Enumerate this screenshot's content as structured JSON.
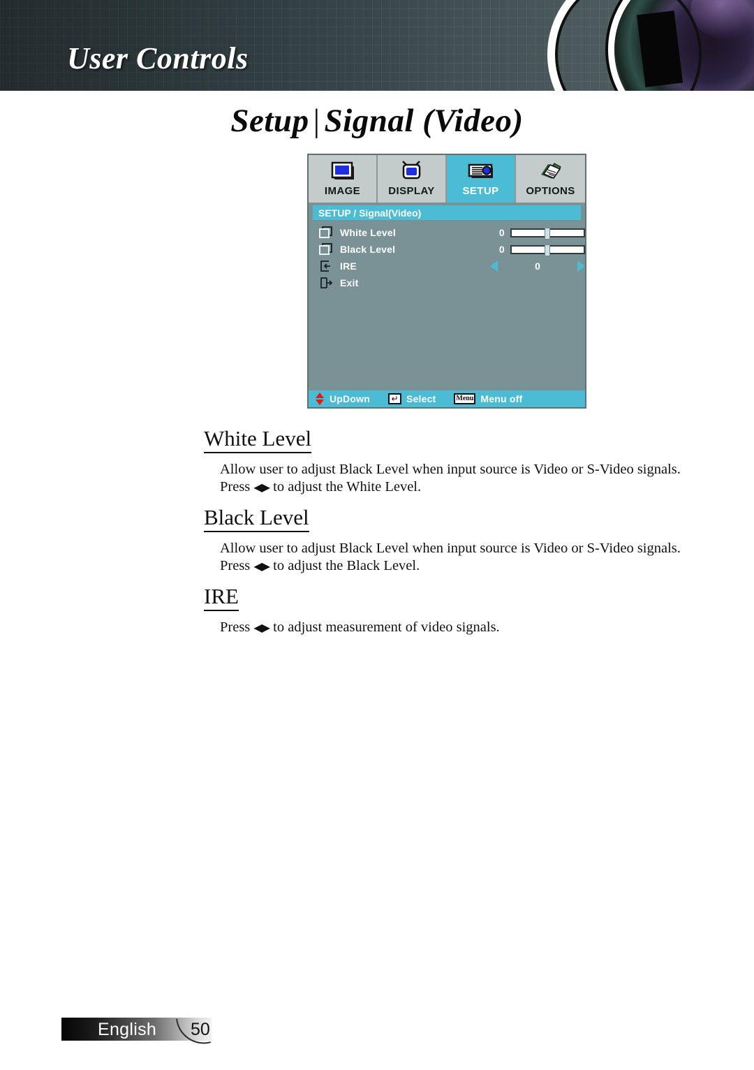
{
  "header": {
    "chapter_title": "User Controls",
    "lens_graphic": "camera-lens"
  },
  "page_title": {
    "prefix": "Setup",
    "separator": "|",
    "suffix": "Signal (Video)"
  },
  "osd": {
    "tabs": [
      {
        "label": "IMAGE",
        "icon": "image-screen-icon",
        "active": false
      },
      {
        "label": "DISPLAY",
        "icon": "television-icon",
        "active": false
      },
      {
        "label": "SETUP",
        "icon": "projector-icon",
        "active": true
      },
      {
        "label": "OPTIONS",
        "icon": "notepad-pencil-icon",
        "active": false
      }
    ],
    "breadcrumb": "SETUP / Signal(Video)",
    "rows": [
      {
        "label": "White Level",
        "value": "0",
        "control": "slider",
        "icon": "stacked-squares-icon"
      },
      {
        "label": "Black Level",
        "value": "0",
        "control": "slider",
        "icon": "stacked-squares-icon"
      },
      {
        "label": "IRE",
        "value": "0",
        "control": "arrows",
        "icon": "enter-box-icon"
      },
      {
        "label": "Exit",
        "value": "",
        "control": "none",
        "icon": "exit-door-icon"
      }
    ],
    "footer": [
      {
        "label": "UpDown",
        "icon": "updown-arrows-icon"
      },
      {
        "label": "Select",
        "icon": "enter-key-icon"
      },
      {
        "label": "Menu off",
        "icon": "menu-button-icon",
        "icon_text": "Menu"
      }
    ],
    "colors": {
      "accent": "#4bbcd4",
      "panel": "#7a9296",
      "tab": "#c3cbcb"
    }
  },
  "sections": [
    {
      "heading": "White Level",
      "body_before": "Allow user to adjust Black Level when input source is Video or S-Video signals. Press ",
      "body_after": " to adjust the White Level.",
      "arrows": "◀▶"
    },
    {
      "heading": "Black Level",
      "body_before": "Allow user to adjust Black Level when input source is Video or S-Video signals. Press ",
      "body_after": " to adjust the Black Level.",
      "arrows": "◀▶"
    },
    {
      "heading": "IRE",
      "body_before": "Press ",
      "body_after": " to adjust measurement of video signals.",
      "arrows": "◀▶"
    }
  ],
  "footer": {
    "language": "English",
    "page_number": "50"
  }
}
